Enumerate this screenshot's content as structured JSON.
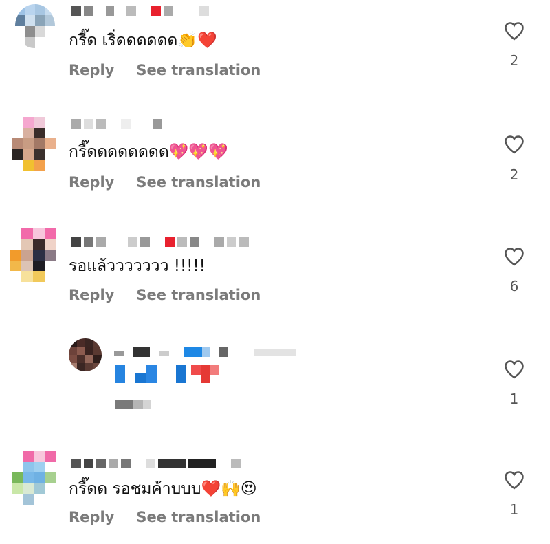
{
  "comments": [
    {
      "text": "กรี๊ด เริ่ดดดดดด",
      "emoji": "👏❤️",
      "reply": "Reply",
      "translate": "See translation",
      "likes": "2"
    },
    {
      "text": "กรี๊ดดดดดดดด",
      "emoji": "💖💖💖",
      "reply": "Reply",
      "translate": "See translation",
      "likes": "2"
    },
    {
      "text": "รอแล้ววววววว !!!!!",
      "emoji": "",
      "reply": "Reply",
      "translate": "See translation",
      "likes": "6"
    },
    {
      "text": "",
      "emoji": "",
      "reply": "",
      "translate": "",
      "likes": "1"
    },
    {
      "text": "กรี๊ดด รอชมค้าบบบ",
      "emoji": "❤️🙌😍",
      "reply": "Reply",
      "translate": "See translation",
      "likes": "1"
    }
  ],
  "colors": {
    "action_gray": "#7b7b7b",
    "like_gray": "#555555"
  },
  "icons": {
    "like": "heart-outline-icon"
  }
}
